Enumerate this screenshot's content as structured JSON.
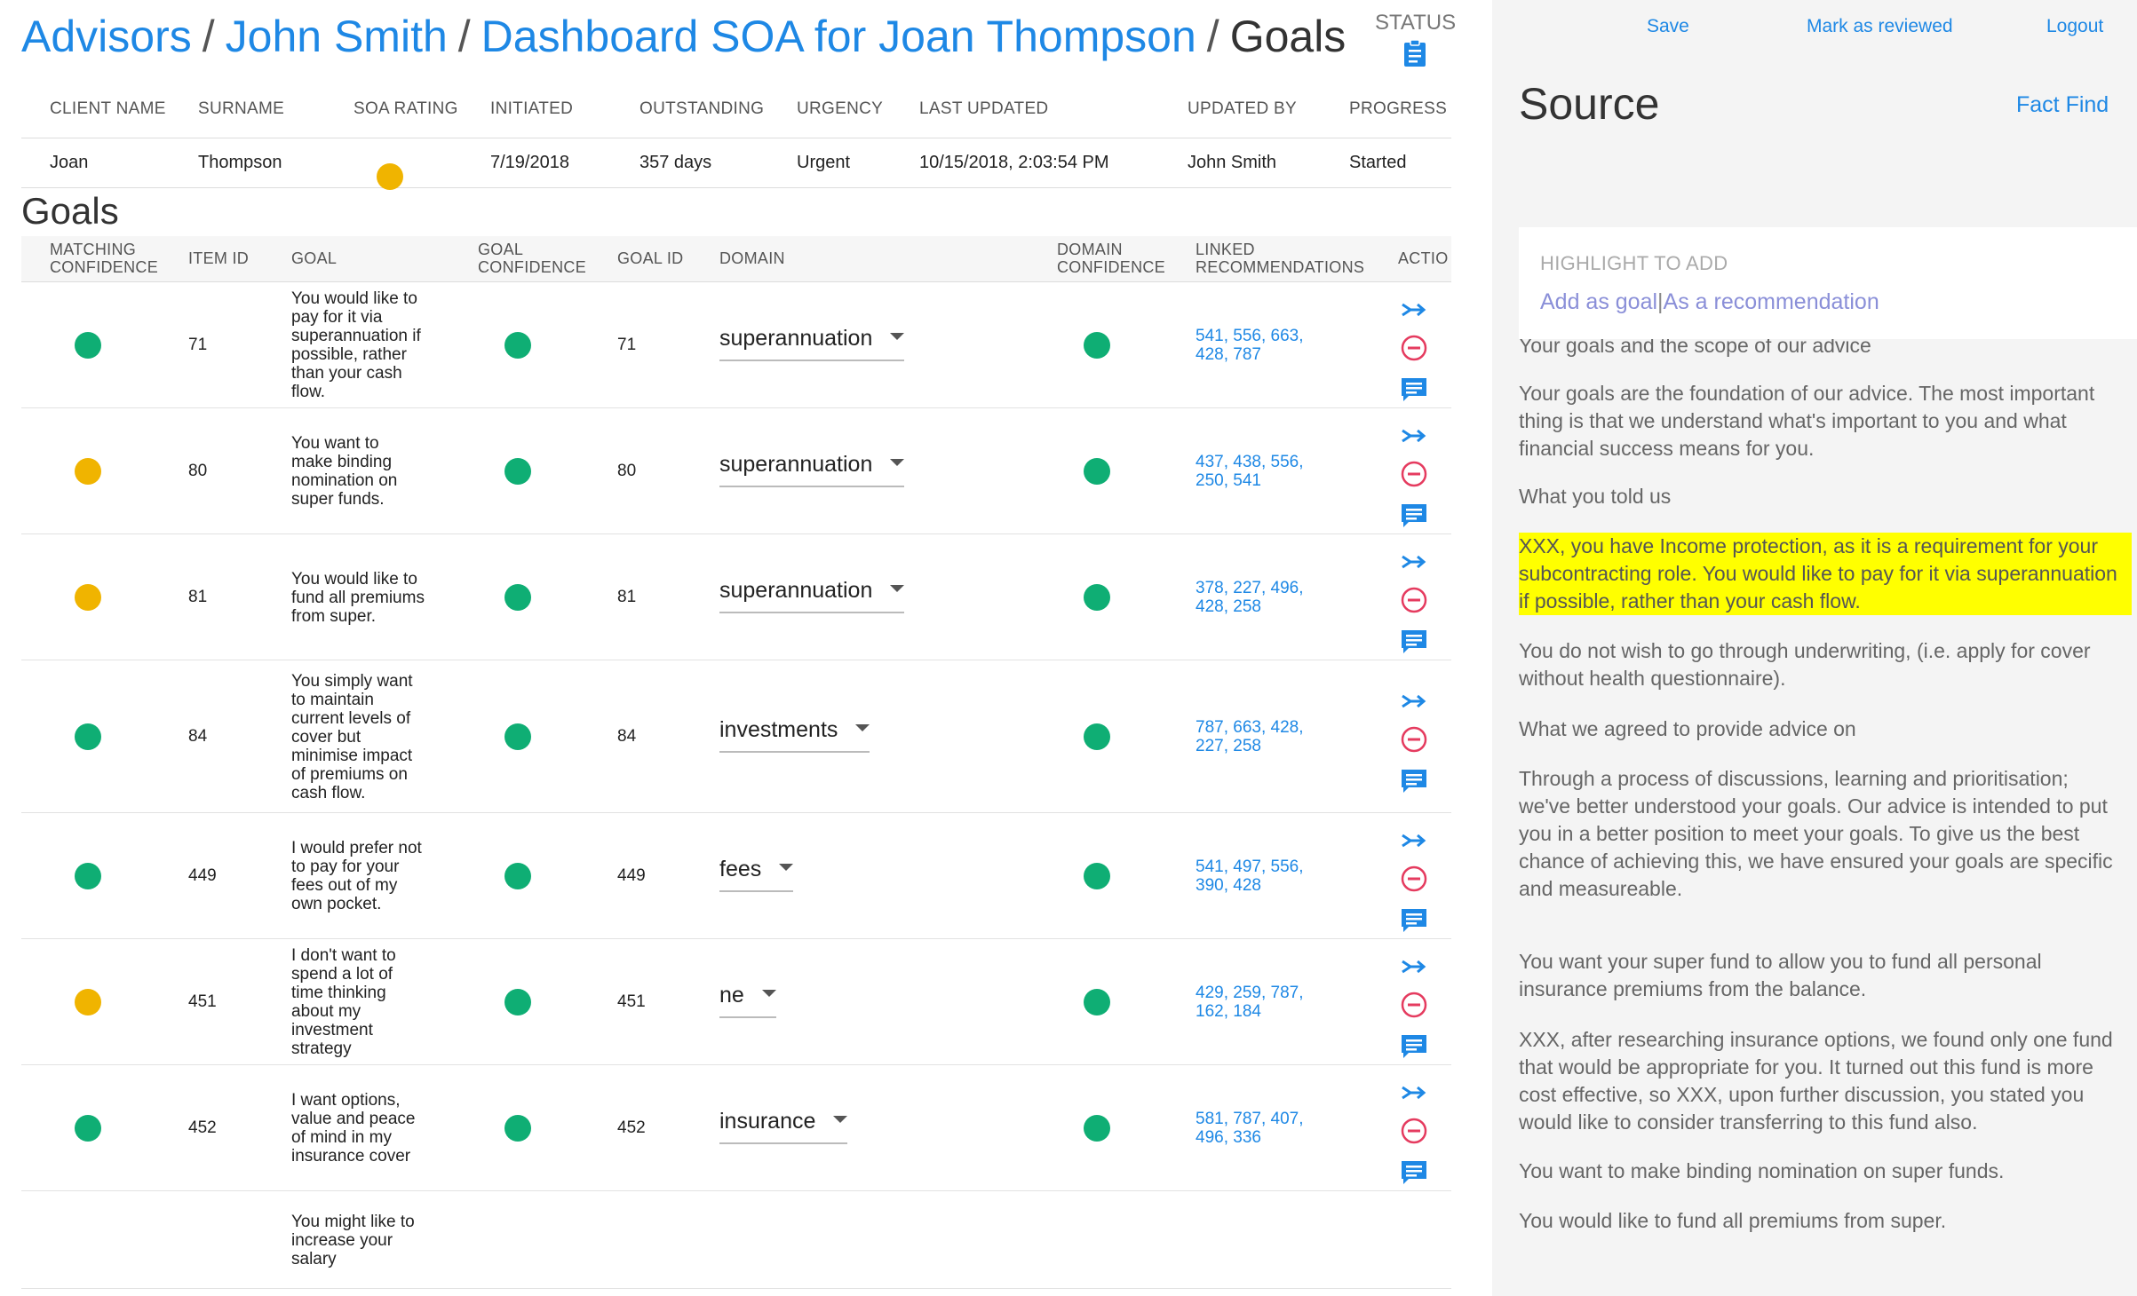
{
  "breadcrumb": {
    "items": [
      "Advisors",
      "John Smith",
      "Dashboard SOA for Joan Thompson"
    ],
    "current": "Goals"
  },
  "status": {
    "label": "STATUS",
    "icon": "clipboard-icon"
  },
  "summary": {
    "headers": [
      "CLIENT NAME",
      "SURNAME",
      "SOA RATING",
      "INITIATED",
      "OUTSTANDING",
      "URGENCY",
      "LAST UPDATED",
      "UPDATED BY",
      "PROGRESS"
    ],
    "row": {
      "client_name": "Joan",
      "surname": "Thompson",
      "soa_rating_color": "#f0b400",
      "initiated": "7/19/2018",
      "outstanding": "357 days",
      "urgency": "Urgent",
      "last_updated": "10/15/2018, 2:03:54 PM",
      "updated_by": "John Smith",
      "progress": "Started"
    }
  },
  "goals_title": "Goals",
  "goals_table": {
    "headers": {
      "matching_confidence": [
        "MATCHING",
        "CONFIDENCE"
      ],
      "item_id": "ITEM ID",
      "goal": "GOAL",
      "goal_confidence": [
        "GOAL",
        "CONFIDENCE"
      ],
      "goal_id": "GOAL ID",
      "domain": "DOMAIN",
      "domain_confidence": [
        "DOMAIN",
        "CONFIDENCE"
      ],
      "linked_recommendations": [
        "LINKED",
        "RECOMMENDATIONS"
      ],
      "actions": "ACTIO"
    },
    "rows": [
      {
        "match": "#0fae74",
        "item_id": "71",
        "goal": "You would like to pay for it via superannuation if possible, rather than your cash flow.",
        "goal_conf": "#0fae74",
        "goal_id": "71",
        "domain": "superannuation",
        "domain_conf": "#0fae74",
        "links": [
          "541, 556, 663,",
          "428, 787"
        ]
      },
      {
        "match": "#f0b400",
        "item_id": "80",
        "goal": "You want to make binding nomination on super funds.",
        "goal_conf": "#0fae74",
        "goal_id": "80",
        "domain": "superannuation",
        "domain_conf": "#0fae74",
        "links": [
          "437, 438, 556,",
          "250, 541"
        ]
      },
      {
        "match": "#f0b400",
        "item_id": "81",
        "goal": "You would like to fund all premiums from super.",
        "goal_conf": "#0fae74",
        "goal_id": "81",
        "domain": "superannuation",
        "domain_conf": "#0fae74",
        "links": [
          "378, 227, 496,",
          "428, 258"
        ]
      },
      {
        "match": "#0fae74",
        "item_id": "84",
        "goal": "You simply want to maintain current levels of cover but minimise impact of premiums on cash flow.",
        "goal_conf": "#0fae74",
        "goal_id": "84",
        "domain": "investments",
        "domain_conf": "#0fae74",
        "links": [
          "787, 663, 428,",
          "227, 258"
        ]
      },
      {
        "match": "#0fae74",
        "item_id": "449",
        "goal": "I would prefer not to pay for your fees out of my own pocket.",
        "goal_conf": "#0fae74",
        "goal_id": "449",
        "domain": "fees",
        "domain_conf": "#0fae74",
        "links": [
          "541, 497, 556,",
          "390, 428"
        ]
      },
      {
        "match": "#f0b400",
        "item_id": "451",
        "goal": "I don't want to spend a lot of time thinking about my investment strategy",
        "goal_conf": "#0fae74",
        "goal_id": "451",
        "domain": "ne",
        "domain_conf": "#0fae74",
        "links": [
          "429, 259, 787,",
          "162, 184"
        ]
      },
      {
        "match": "#0fae74",
        "item_id": "452",
        "goal": "I want options, value and peace of mind in my insurance cover",
        "goal_conf": "#0fae74",
        "goal_id": "452",
        "domain": "insurance",
        "domain_conf": "#0fae74",
        "links": [
          "581, 787, 407,",
          "496, 336"
        ]
      },
      {
        "match": "",
        "item_id": "",
        "goal": "You might like to increase your salary",
        "goal_conf": "",
        "goal_id": "",
        "domain": "",
        "domain_conf": "",
        "links": []
      }
    ],
    "action_icons": [
      "split-arrow-icon",
      "remove-circle-icon",
      "comment-icon"
    ]
  },
  "right_panel": {
    "nav": {
      "save": "Save",
      "mark_reviewed": "Mark as reviewed",
      "logout": "Logout"
    },
    "title": "Source",
    "fact_find": "Fact Find",
    "highlight": {
      "label": "HIGHLIGHT TO ADD",
      "add_goal": "Add as goal",
      "separator": "|",
      "add_rec": "As a recommendation"
    },
    "paragraphs": [
      {
        "text": "Your goals and the scope of our advice",
        "highlight": false
      },
      {
        "text": "Your goals are the foundation of our advice. The most important thing is that we understand what's important to you and what financial success means for you.",
        "highlight": false
      },
      {
        "text": "What you told us",
        "highlight": false
      },
      {
        "text": "XXX, you have Income protection, as it is a requirement for your subcontracting role. You would like to pay for it via superannuation if possible, rather than your cash flow.",
        "highlight": true
      },
      {
        "text": "You do not wish to go through underwriting, (i.e. apply for cover without health questionnaire).",
        "highlight": false
      },
      {
        "text": "What we agreed to provide advice on",
        "highlight": false
      },
      {
        "text": "Through a process of discussions, learning and prioritisation; we've better understood your goals. Our advice is intended to put you in a better position to meet your goals. To give us the best chance of achieving this, we have ensured your goals are specific and measureable.",
        "highlight": false
      },
      {
        "text": "You want your super fund to allow you to fund all personal insurance premiums from the balance.",
        "highlight": false
      },
      {
        "text": "XXX, after researching insurance options, we found only one fund that would be appropriate for you. It turned out this fund is more cost effective, so XXX, upon further discussion, you stated you would like to consider transferring to this fund also.",
        "highlight": false
      },
      {
        "text": "You want to make binding nomination on super funds.",
        "highlight": false
      },
      {
        "text": "You would like to fund all premiums from super.",
        "highlight": false
      }
    ]
  }
}
